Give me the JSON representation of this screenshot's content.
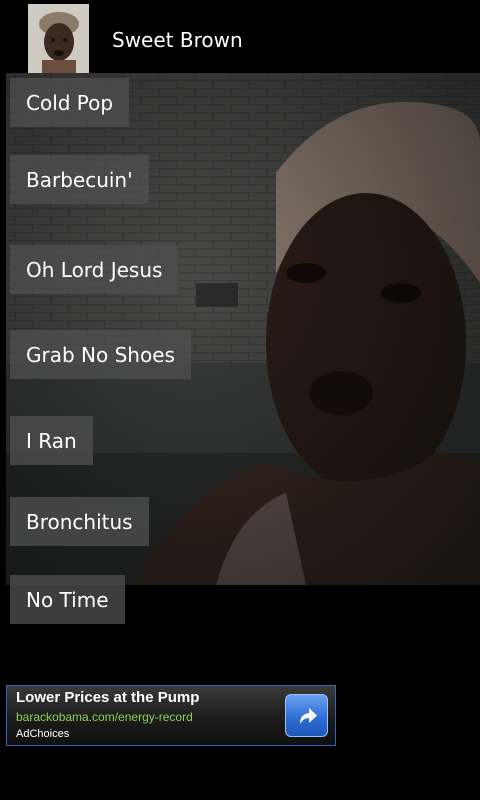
{
  "app": {
    "title": "Sweet Brown",
    "icon": "sweet-brown-avatar"
  },
  "buttons": [
    {
      "label": "Cold Pop"
    },
    {
      "label": "Barbecuin'"
    },
    {
      "label": "Oh Lord Jesus"
    },
    {
      "label": "Grab No Shoes"
    },
    {
      "label": "I Ran"
    },
    {
      "label": "Bronchitus"
    },
    {
      "label": "No Time"
    }
  ],
  "ad": {
    "headline": "Lower Prices at the Pump",
    "url": "barackobama.com/energy-record",
    "choices": "AdChoices",
    "action_icon": "share-arrow-icon",
    "border_color": "#3b63b5",
    "url_color": "#8fd14f"
  }
}
